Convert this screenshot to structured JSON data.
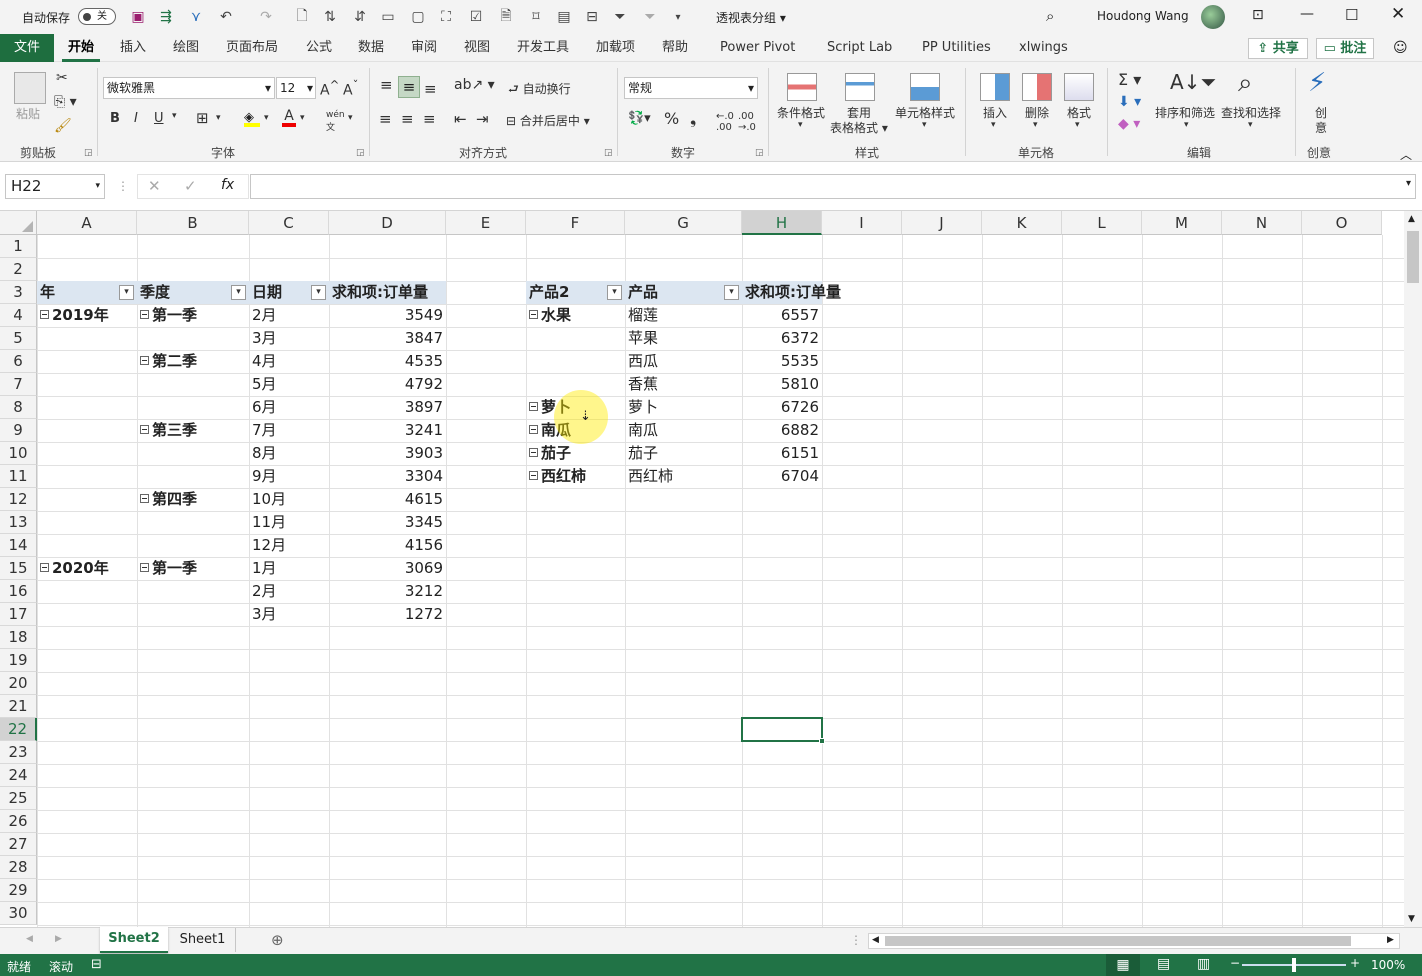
{
  "titlebar": {
    "autosave_label": "自动保存",
    "autosave_state": "关",
    "doc_title": "透视表分组",
    "user": "Houdong Wang"
  },
  "tabs": [
    "文件",
    "开始",
    "插入",
    "绘图",
    "页面布局",
    "公式",
    "数据",
    "审阅",
    "视图",
    "开发工具",
    "加载项",
    "帮助",
    "Power Pivot",
    "Script Lab",
    "PP Utilities",
    "xlwings"
  ],
  "share_label": "共享",
  "comment_label": "批注",
  "ribbon": {
    "clipboard": {
      "paste": "粘贴",
      "label": "剪贴板"
    },
    "font": {
      "name": "微软雅黑",
      "size": "12",
      "label": "字体",
      "bold": "B",
      "italic": "I",
      "underline": "U"
    },
    "align": {
      "wrap": "自动换行",
      "merge": "合并后居中",
      "label": "对齐方式"
    },
    "number": {
      "format": "常规",
      "label": "数字"
    },
    "styles": {
      "cond": "条件格式",
      "table1": "套用",
      "table2": "表格格式",
      "cellstyle": "单元格样式",
      "label": "样式"
    },
    "cells": {
      "insert": "插入",
      "delete": "删除",
      "format": "格式",
      "label": "单元格"
    },
    "editing": {
      "sort": "排序和筛选",
      "find": "查找和选择",
      "label": "编辑"
    },
    "ideas": {
      "l1": "创",
      "l2": "意",
      "label": "创意"
    }
  },
  "namebox": "H22",
  "fx": "fx",
  "columns": [
    "A",
    "B",
    "C",
    "D",
    "E",
    "F",
    "G",
    "H",
    "I",
    "J",
    "K",
    "L",
    "M",
    "N",
    "O"
  ],
  "rows": [
    "1",
    "2",
    "3",
    "4",
    "5",
    "6",
    "7",
    "8",
    "9",
    "10",
    "11",
    "12",
    "13",
    "14",
    "15",
    "16",
    "17",
    "18",
    "19",
    "20",
    "21",
    "22",
    "23",
    "24",
    "25",
    "26",
    "27",
    "28",
    "29",
    "30"
  ],
  "pivot1": {
    "headers": [
      "年",
      "季度",
      "日期",
      "求和项:订单量"
    ],
    "rows": [
      {
        "year": "2019年",
        "quarter": "第一季",
        "date": "2月",
        "value": "3549"
      },
      {
        "year": "",
        "quarter": "",
        "date": "3月",
        "value": "3847"
      },
      {
        "year": "",
        "quarter": "第二季",
        "date": "4月",
        "value": "4535"
      },
      {
        "year": "",
        "quarter": "",
        "date": "5月",
        "value": "4792"
      },
      {
        "year": "",
        "quarter": "",
        "date": "6月",
        "value": "3897"
      },
      {
        "year": "",
        "quarter": "第三季",
        "date": "7月",
        "value": "3241"
      },
      {
        "year": "",
        "quarter": "",
        "date": "8月",
        "value": "3903"
      },
      {
        "year": "",
        "quarter": "",
        "date": "9月",
        "value": "3304"
      },
      {
        "year": "",
        "quarter": "第四季",
        "date": "10月",
        "value": "4615"
      },
      {
        "year": "",
        "quarter": "",
        "date": "11月",
        "value": "3345"
      },
      {
        "year": "",
        "quarter": "",
        "date": "12月",
        "value": "4156"
      },
      {
        "year": "2020年",
        "quarter": "第一季",
        "date": "1月",
        "value": "3069"
      },
      {
        "year": "",
        "quarter": "",
        "date": "2月",
        "value": "3212"
      },
      {
        "year": "",
        "quarter": "",
        "date": "3月",
        "value": "1272"
      }
    ]
  },
  "pivot2": {
    "headers": [
      "产品2",
      "产品",
      "求和项:订单量"
    ],
    "rows": [
      {
        "group": "水果",
        "product": "榴莲",
        "value": "6557"
      },
      {
        "group": "",
        "product": "苹果",
        "value": "6372"
      },
      {
        "group": "",
        "product": "西瓜",
        "value": "5535"
      },
      {
        "group": "",
        "product": "香蕉",
        "value": "5810"
      },
      {
        "group": "萝卜",
        "product": "萝卜",
        "value": "6726"
      },
      {
        "group": "南瓜",
        "product": "南瓜",
        "value": "6882"
      },
      {
        "group": "茄子",
        "product": "茄子",
        "value": "6151"
      },
      {
        "group": "西红柿",
        "product": "西红柿",
        "value": "6704"
      }
    ]
  },
  "sheets": [
    "Sheet2",
    "Sheet1"
  ],
  "status": {
    "ready": "就绪",
    "scroll": "滚动",
    "zoom": "100%"
  },
  "colors": {
    "accent": "#217346",
    "pivot_header": "#dce6f1"
  }
}
